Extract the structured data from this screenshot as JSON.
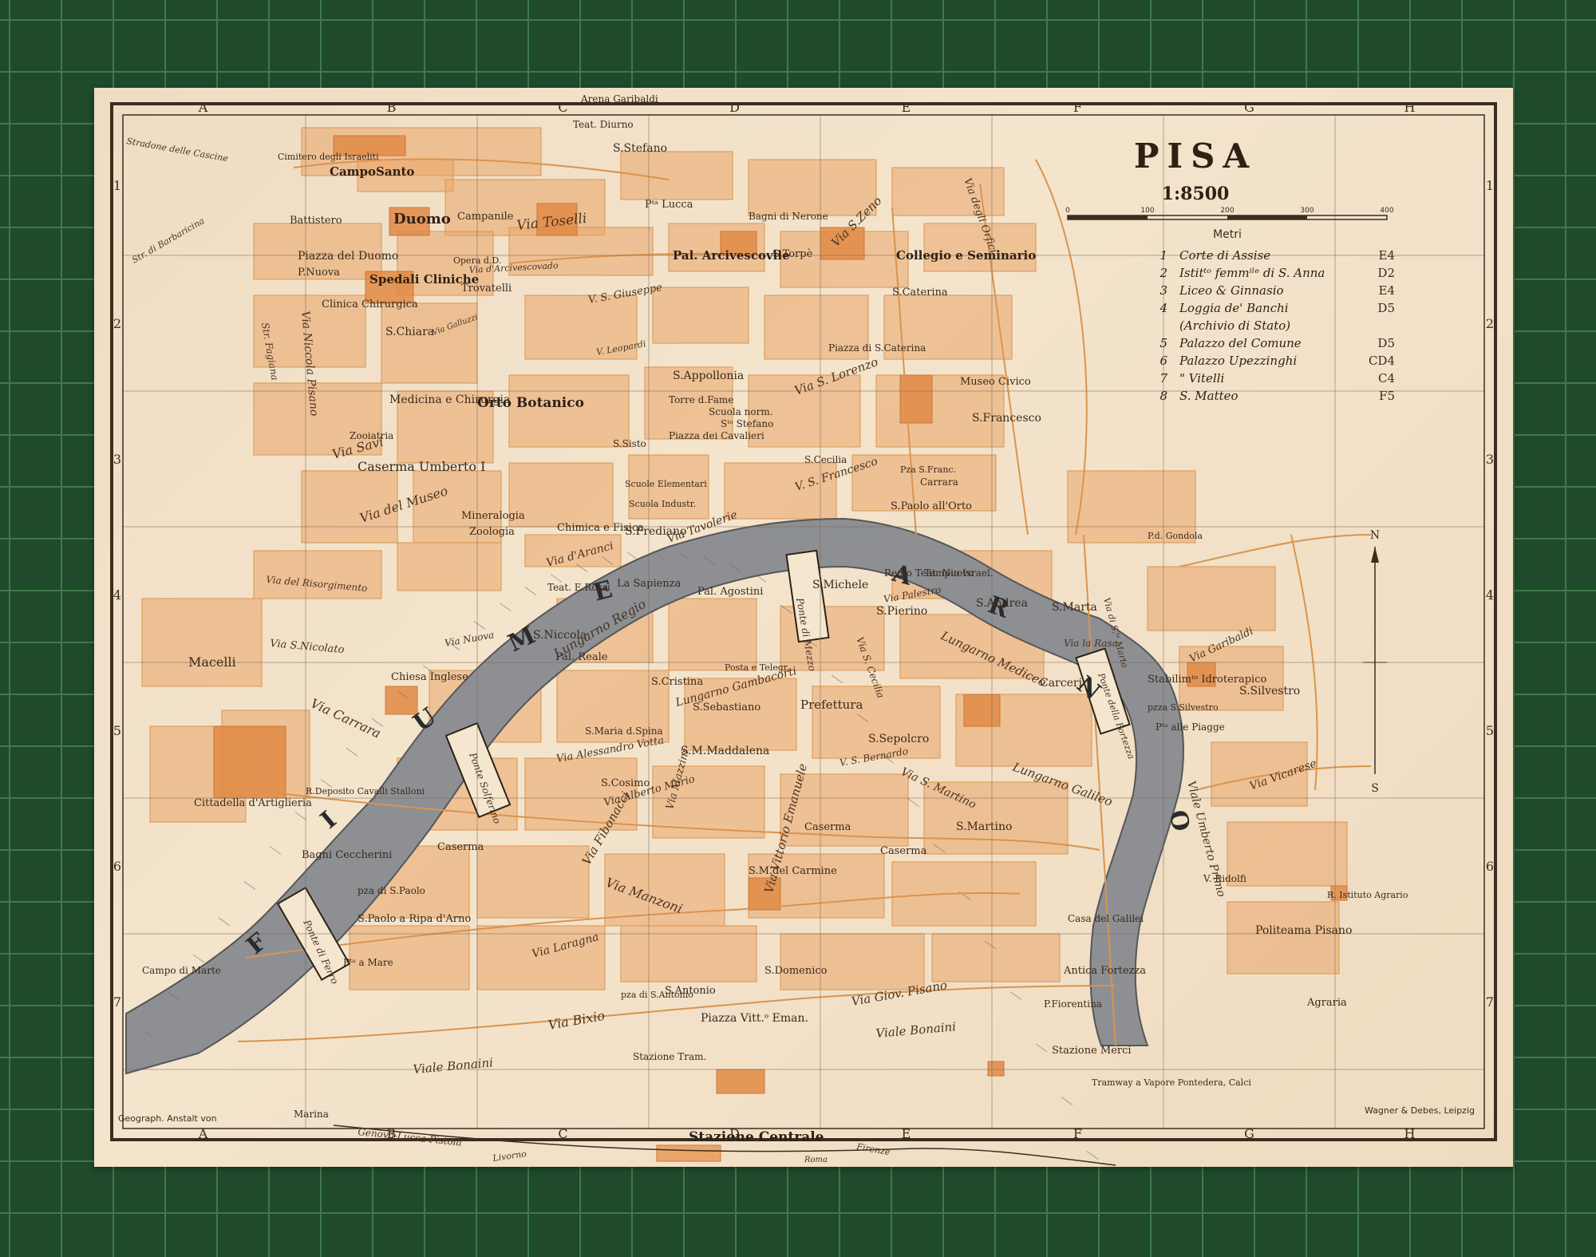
{
  "title": "PISA",
  "scale": "1:8500",
  "scale_bar": {
    "unit_label": "Metri",
    "ticks": [
      "0",
      "100",
      "200",
      "300",
      "400"
    ]
  },
  "legend": [
    {
      "n": "1",
      "name": "Corte di Assise",
      "ref": "E4"
    },
    {
      "n": "2",
      "name": "Istitᵗᵒ femmⁱˡᵉ di S. Anna",
      "ref": "D2"
    },
    {
      "n": "3",
      "name": "Liceo & Ginnasio",
      "ref": "E4"
    },
    {
      "n": "4",
      "name": "Loggia de' Banchi",
      "ref": "D5"
    },
    {
      "n": "",
      "name": "(Archivio di Stato)",
      "ref": ""
    },
    {
      "n": "5",
      "name": "Palazzo del Comune",
      "ref": "D5"
    },
    {
      "n": "6",
      "name": "Palazzo Upezzinghi",
      "ref": "CD4"
    },
    {
      "n": "7",
      "name": "\"     Vitelli",
      "ref": "C4"
    },
    {
      "n": "8",
      "name": "S. Matteo",
      "ref": "F5"
    }
  ],
  "grid": {
    "columns": [
      "A",
      "B",
      "C",
      "D",
      "E",
      "F",
      "G",
      "H"
    ],
    "rows": [
      "1",
      "2",
      "3",
      "4",
      "5",
      "6",
      "7"
    ]
  },
  "compass": {
    "north": "N",
    "south": "S"
  },
  "river": {
    "letters": [
      "F",
      "I",
      "U",
      "M",
      "E",
      "A",
      "R",
      "N",
      "O"
    ]
  },
  "places": [
    {
      "id": "arena-garibaldi",
      "text": "Arena Garibaldi"
    },
    {
      "id": "teat-diurno",
      "text": "Teat. Diurno"
    },
    {
      "id": "s-stefano",
      "text": "S.Stefano"
    },
    {
      "id": "campo-santo",
      "text": "CampoSanto"
    },
    {
      "id": "cimitero",
      "text": "Cimitero degli Israeliti"
    },
    {
      "id": "battistero",
      "text": "Battistero"
    },
    {
      "id": "duomo",
      "text": "Duomo"
    },
    {
      "id": "campanile",
      "text": "Campanile"
    },
    {
      "id": "pza-lucca",
      "text": "Pᵗᵃ Lucca"
    },
    {
      "id": "bagni-nerone",
      "text": "Bagni di Nerone"
    },
    {
      "id": "piazza-duomo",
      "text": "Piazza del Duomo"
    },
    {
      "id": "p-nuova",
      "text": "P.Nuova"
    },
    {
      "id": "opera",
      "text": "Opera d.D."
    },
    {
      "id": "pal-arcivescovile",
      "text": "Pal. Arcivescovile"
    },
    {
      "id": "s-torpe",
      "text": "S.Torpè"
    },
    {
      "id": "collegio",
      "text": "Collegio e Seminario"
    },
    {
      "id": "spedali",
      "text": "Spedali Cliniche"
    },
    {
      "id": "trovatelli",
      "text": "Trovatelli"
    },
    {
      "id": "clinica",
      "text": "Clinica Chirurgica"
    },
    {
      "id": "s-chiara",
      "text": "S.Chiara"
    },
    {
      "id": "s-caterina",
      "text": "S.Caterina"
    },
    {
      "id": "piazza-s-caterina",
      "text": "Piazza di S.Caterina"
    },
    {
      "id": "s-appollonia",
      "text": "S.Appollonia"
    },
    {
      "id": "museo-civico",
      "text": "Museo Civico"
    },
    {
      "id": "s-francesco",
      "text": "S.Francesco"
    },
    {
      "id": "medicina",
      "text": "Medicina e Chirurgia"
    },
    {
      "id": "orto-botanico",
      "text": "Orto Botanico"
    },
    {
      "id": "torre-fame",
      "text": "Torre d.Fame"
    },
    {
      "id": "scuola-norm",
      "text": "Scuola norm."
    },
    {
      "id": "s-stefano-cav",
      "text": "Sᵗᵒ Stefano"
    },
    {
      "id": "piazza-cavalieri",
      "text": "Piazza dei Cavalieri"
    },
    {
      "id": "zooiatria",
      "text": "Zooiatria"
    },
    {
      "id": "caserma-umberto",
      "text": "Caserma Umberto I"
    },
    {
      "id": "s-sisto",
      "text": "S.Sisto"
    },
    {
      "id": "scuole-elem",
      "text": "Scuole Elementari"
    },
    {
      "id": "scuola-ind",
      "text": "Scuola Industr."
    },
    {
      "id": "s-cecilia",
      "text": "S.Cecilia"
    },
    {
      "id": "pza-franc",
      "text": "Pza S.Franc."
    },
    {
      "id": "carrara",
      "text": "Carrara"
    },
    {
      "id": "mineralogia",
      "text": "Mineralogia"
    },
    {
      "id": "zoologia",
      "text": "Zoologia"
    },
    {
      "id": "chimica",
      "text": "Chimica e Fisica"
    },
    {
      "id": "s-frediano",
      "text": "S.Frediano"
    },
    {
      "id": "s-paolo-orto",
      "text": "S.Paolo all'Orto"
    },
    {
      "id": "pd-gondola",
      "text": "P.d. Gondola"
    },
    {
      "id": "teat-rossi",
      "text": "Teat. E.Rossi"
    },
    {
      "id": "la-sapienza",
      "text": "La Sapienza"
    },
    {
      "id": "pal-agostini",
      "text": "Pal. Agostini"
    },
    {
      "id": "s-michele",
      "text": "S.Michele"
    },
    {
      "id": "regio-teat",
      "text": "Regio Teat. Nuovo"
    },
    {
      "id": "tempio-israel",
      "text": "Tempio Israel."
    },
    {
      "id": "s-andrea",
      "text": "S.Andrea"
    },
    {
      "id": "s-marta",
      "text": "S.Marta"
    },
    {
      "id": "s-pierino",
      "text": "S.Pierino"
    },
    {
      "id": "s-niccola",
      "text": "S.Niccola"
    },
    {
      "id": "pal-reale",
      "text": "Pal. Reale"
    },
    {
      "id": "macelli",
      "text": "Macelli"
    },
    {
      "id": "chiesa-inglese",
      "text": "Chiesa Inglese"
    },
    {
      "id": "s-cristina",
      "text": "S.Cristina"
    },
    {
      "id": "posta",
      "text": "Posta e Telegr."
    },
    {
      "id": "prefettura",
      "text": "Prefettura"
    },
    {
      "id": "carceri",
      "text": "Carceri"
    },
    {
      "id": "stabilim",
      "text": "Stabilimᵗᵒ Idroterapico"
    },
    {
      "id": "s-silvestro",
      "text": "S.Silvestro"
    },
    {
      "id": "pza-silvestro",
      "text": "pzza S.Silvestro"
    },
    {
      "id": "piagge",
      "text": "Pᵗᵃ alle Piagge"
    },
    {
      "id": "s-sebastiano",
      "text": "S.Sebastiano"
    },
    {
      "id": "s-maria-spina",
      "text": "S.Maria d.Spina"
    },
    {
      "id": "s-maddalena",
      "text": "S.M.Maddalena"
    },
    {
      "id": "s-sepolcro",
      "text": "S.Sepolcro"
    },
    {
      "id": "s-cosimo",
      "text": "S.Cosimo"
    },
    {
      "id": "cittadella",
      "text": "Cittadella d'Artiglieria"
    },
    {
      "id": "deposito",
      "text": "R.Deposito Cavalli Stalloni"
    },
    {
      "id": "bagni-cecc",
      "text": "Bagni Ceccherini"
    },
    {
      "id": "caserma-1",
      "text": "Caserma"
    },
    {
      "id": "caserma-2",
      "text": "Caserma"
    },
    {
      "id": "caserma-3",
      "text": "Caserma"
    },
    {
      "id": "s-martino",
      "text": "S.Martino"
    },
    {
      "id": "s-m-carmine",
      "text": "S.M.del Carmine"
    },
    {
      "id": "v-ridolfi",
      "text": "V. Ridolfi"
    },
    {
      "id": "istituto-agrario",
      "text": "R. Istituto Agrario"
    },
    {
      "id": "politeama",
      "text": "Politeama Pisano"
    },
    {
      "id": "casa-galilei",
      "text": "Casa del Galilei"
    },
    {
      "id": "s-paolo-ripa",
      "text": "S.Paolo a Ripa d'Arno"
    },
    {
      "id": "pza-s-paolo",
      "text": "pza di S.Paolo"
    },
    {
      "id": "pta-mare",
      "text": "Pᵗᵃ a Mare"
    },
    {
      "id": "s-domenico",
      "text": "S.Domenico"
    },
    {
      "id": "s-antonio",
      "text": "S.Antonio"
    },
    {
      "id": "pza-s-antonio",
      "text": "pza di S.Antonio"
    },
    {
      "id": "antica-fortezza",
      "text": "Antica Fortezza"
    },
    {
      "id": "p-fiorentina",
      "text": "P.Fiorentina"
    },
    {
      "id": "agraria",
      "text": "Agraria"
    },
    {
      "id": "piazza-vitt",
      "text": "Piazza Vitt.ᵒ Eman."
    },
    {
      "id": "stazione-tram",
      "text": "Stazione Tram."
    },
    {
      "id": "stazione-merci",
      "text": "Stazione Merci"
    },
    {
      "id": "tramway",
      "text": "Tramway a Vapore Pontedera, Calci"
    },
    {
      "id": "marina",
      "text": "Marina"
    },
    {
      "id": "campo-marte",
      "text": "Campo di Marte"
    },
    {
      "id": "stazione-centrale",
      "text": "Stazione Centrale"
    }
  ],
  "streets": [
    {
      "id": "stradone-cascine",
      "text": "Stradone delle Cascine"
    },
    {
      "id": "str-barbaricina",
      "text": "Str. di Barbaricina"
    },
    {
      "id": "via-toselli",
      "text": "Via Toselli"
    },
    {
      "id": "via-arcivescovado",
      "text": "Via d'Arcivescovado"
    },
    {
      "id": "via-s-zeno",
      "text": "Via S.Zeno"
    },
    {
      "id": "via-orfici",
      "text": "Via degli Orfici"
    },
    {
      "id": "via-s-giuseppe",
      "text": "V. S. Giuseppe"
    },
    {
      "id": "str-fagiana",
      "text": "Str. Fagiana"
    },
    {
      "id": "via-niccola-pisano",
      "text": "Via Niccola Pisano"
    },
    {
      "id": "via-galluzzi",
      "text": "Via Galluzzi"
    },
    {
      "id": "via-leopardi",
      "text": "V. Leopardi"
    },
    {
      "id": "via-s-lorenzo",
      "text": "Via S. Lorenzo"
    },
    {
      "id": "via-savi",
      "text": "Via Savi"
    },
    {
      "id": "via-museo",
      "text": "Via del Museo"
    },
    {
      "id": "via-s-francesco",
      "text": "V. S. Francesco"
    },
    {
      "id": "via-tavolerie",
      "text": "Via Tavolerie"
    },
    {
      "id": "via-aranci",
      "text": "Via d'Aranci"
    },
    {
      "id": "via-risorgimento",
      "text": "Via del Risorgimento"
    },
    {
      "id": "via-s-nicolato",
      "text": "Via S.Nicolato"
    },
    {
      "id": "via-nuova",
      "text": "Via Nuova"
    },
    {
      "id": "via-carrara",
      "text": "Via Carrara"
    },
    {
      "id": "lungarno-regio",
      "text": "Lungarno Regio"
    },
    {
      "id": "lungarno-mediceo",
      "text": "Lungarno Mediceo"
    },
    {
      "id": "via-palestro",
      "text": "Via Palestro"
    },
    {
      "id": "via-rasa",
      "text": "Via la Rasa"
    },
    {
      "id": "via-s-marta",
      "text": "Via di S.ᵗᵃ Marta"
    },
    {
      "id": "via-garibaldi",
      "text": "Via Garibaldi"
    },
    {
      "id": "via-vicarese",
      "text": "Via Vicarese"
    },
    {
      "id": "viale-umberto",
      "text": "Viale Umberto Primo"
    },
    {
      "id": "lungarno-galileo",
      "text": "Lungarno Galileo"
    },
    {
      "id": "via-s-martino",
      "text": "Via S. Martino"
    },
    {
      "id": "lungarno-gambacorti",
      "text": "Lungarno Gambacorti"
    },
    {
      "id": "via-a-vota",
      "text": "Via Alessandro Votta"
    },
    {
      "id": "via-a-mario",
      "text": "Via Alberto Mario"
    },
    {
      "id": "via-fibonacci",
      "text": "Via Fibonacci"
    },
    {
      "id": "via-manzoni",
      "text": "Via Manzoni"
    },
    {
      "id": "via-laragna",
      "text": "Via Laragna"
    },
    {
      "id": "via-v-emanuele",
      "text": "Via Vittorio Emanuele"
    },
    {
      "id": "via-mazzini",
      "text": "Via Mazzini"
    },
    {
      "id": "via-bixio",
      "text": "Via Bixio"
    },
    {
      "id": "viale-bonaini",
      "text": "Viale Bonaini"
    },
    {
      "id": "viale-bonaini-2",
      "text": "Viale Bonaini"
    },
    {
      "id": "via-giov-pisano",
      "text": "Via Giov. Pisano"
    },
    {
      "id": "via-s-bernardo",
      "text": "V. S. Bernardo"
    },
    {
      "id": "via-s-cecilia",
      "text": "Via S. Cecilia"
    },
    {
      "id": "ponte-solferino",
      "text": "Ponte Solferino"
    },
    {
      "id": "ponte-mezzo",
      "text": "Ponte di Mezzo"
    },
    {
      "id": "ponte-fortezza",
      "text": "Ponte della Fortezza"
    },
    {
      "id": "ponte-ferro",
      "text": "Ponte di Ferro"
    }
  ],
  "imprint": {
    "left": "Geograph. Anstalt von",
    "right": "Wagner & Debes, Leipzig"
  },
  "railways": [
    {
      "id": "rail-genova",
      "text": "Genova-Lucca-Pistoia"
    },
    {
      "id": "rail-livorno",
      "text": "Livorno"
    },
    {
      "id": "rail-firenze",
      "text": "Firenze"
    },
    {
      "id": "rail-roma",
      "text": "Roma"
    }
  ],
  "colors": {
    "paper": "#f2e1c8",
    "building": "#eaa66a",
    "building_dark": "#e08a45",
    "street_line": "#d9944f",
    "river": "#8d8f93",
    "frame": "#3b2d20",
    "mat": "#1f4a2c",
    "mat_grid": "#3f7a4a"
  }
}
